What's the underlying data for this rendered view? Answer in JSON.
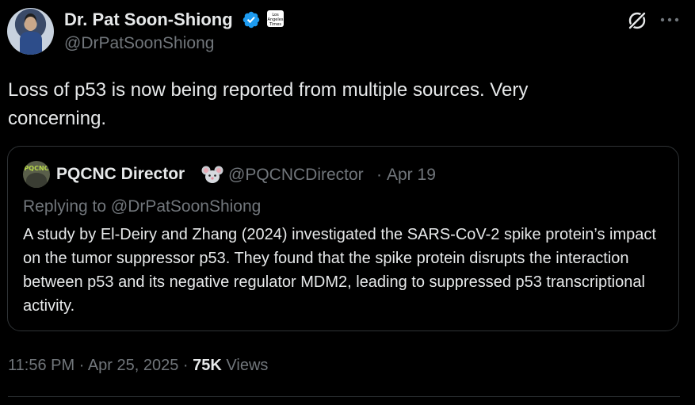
{
  "author": {
    "name": "Dr. Pat Soon-Shiong",
    "handle": "@DrPatSoonShiong",
    "affiliate_badge_text": "Los Angeles Times"
  },
  "tweet": {
    "text": "Loss of p53 is now being reported from multiple sources. Very concerning."
  },
  "quote": {
    "avatar_text": "PQCNC",
    "name": "PQCNC Director",
    "name_emoji_icon": "mouse-face-icon",
    "handle": "@PQCNCDirector",
    "separator": "·",
    "date": "Apr 19",
    "replying_to": "Replying to @DrPatSoonShiong",
    "text": "A study by El-Deiry and Zhang (2024) investigated the SARS-CoV-2 spike protein’s impact on the tumor suppressor p53. They found that the spike protein disrupts the interaction between p53 and its negative regulator MDM2, leading to suppressed p53 transcriptional activity."
  },
  "meta": {
    "time": "11:56 PM",
    "separator": "·",
    "date": "Apr 25, 2025",
    "views_count": "75K",
    "views_label": "Views"
  },
  "icons": {
    "verified": "verified-badge-icon",
    "grok": "grok-icon",
    "more": "more-options-icon"
  },
  "colors": {
    "background": "#000000",
    "primary_text": "#e7e9ea",
    "secondary_text": "#71767b",
    "verified_blue": "#1d9bf0",
    "border": "#2f3336"
  }
}
